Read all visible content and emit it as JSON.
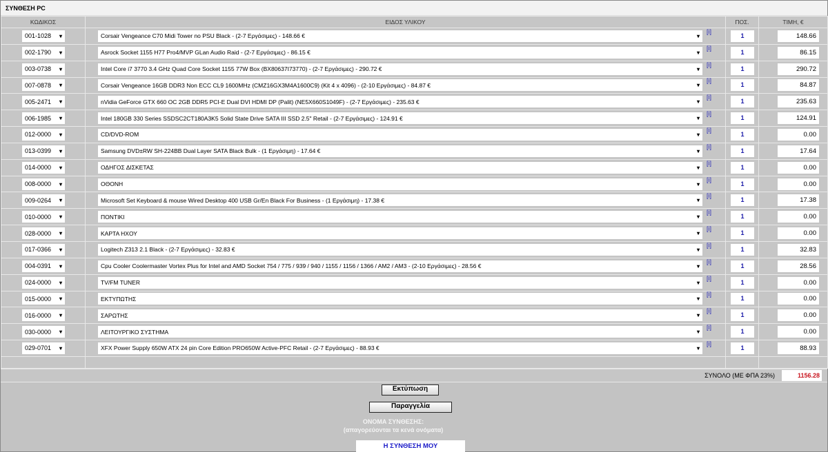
{
  "title": "ΣΥΝΘΕΣΗ PC",
  "headers": {
    "code": "ΚΩΔΙΚΟΣ",
    "desc": "ΕΙΔΟΣ ΥΛΙΚΟΥ",
    "qty": "ΠΟΣ.",
    "price": "ΤΙΜΗ, €"
  },
  "info_label": "[i]",
  "rows": [
    {
      "code": "001-1028",
      "desc": "Corsair Vengeance C70 Midi Tower no PSU Black - (2-7 Εργάσιμες) - 148.66 €",
      "qty": "1",
      "price": "148.66"
    },
    {
      "code": "002-1790",
      "desc": "Asrock Socket 1155 H77 Pro4/MVP GLan Audio Raid - (2-7 Εργάσιμες) - 86.15 €",
      "qty": "1",
      "price": "86.15"
    },
    {
      "code": "003-0738",
      "desc": "Intel Core i7 3770 3.4 GHz Quad Core Socket 1155 77W Box (BX80637I73770) - (2-7 Εργάσιμες) - 290.72 €",
      "qty": "1",
      "price": "290.72"
    },
    {
      "code": "007-0878",
      "desc": "Corsair Vengeance 16GB DDR3 Non ECC CL9 1600MHz (CMZ16GX3M4A1600C9) (Kit 4 x 4096) - (2-10 Εργάσιμες) - 84.87 €",
      "qty": "1",
      "price": "84.87"
    },
    {
      "code": "005-2471",
      "desc": "nVidia GeForce GTX 660 OC 2GB DDR5 PCI-E Dual DVI HDMI DP (Palit) (NE5X660S1049F) - (2-7 Εργάσιμες) - 235.63 €",
      "qty": "1",
      "price": "235.63"
    },
    {
      "code": "006-1985",
      "desc": "Intel 180GB 330 Series SSDSC2CT180A3K5 Solid State Drive SATA III SSD 2.5\" Retail - (2-7 Εργάσιμες) - 124.91 €",
      "qty": "1",
      "price": "124.91"
    },
    {
      "code": "012-0000",
      "desc": "CD/DVD-ROM",
      "qty": "1",
      "price": "0.00"
    },
    {
      "code": "013-0399",
      "desc": "Samsung DVD±RW SH-224BB Dual Layer SATA Black Bulk - (1 Εργάσιμη) - 17.64 €",
      "qty": "1",
      "price": "17.64"
    },
    {
      "code": "014-0000",
      "desc": "ΟΔΗΓΟΣ ΔΙΣΚΕΤΑΣ",
      "qty": "1",
      "price": "0.00"
    },
    {
      "code": "008-0000",
      "desc": "ΟΘΟΝΗ",
      "qty": "1",
      "price": "0.00"
    },
    {
      "code": "009-0264",
      "desc": "Microsoft Set Keyboard & mouse Wired Desktop 400 USB Gr/En Black For Business - (1 Εργάσιμη) - 17.38 €",
      "qty": "1",
      "price": "17.38"
    },
    {
      "code": "010-0000",
      "desc": "ΠΟΝΤΙΚΙ",
      "qty": "1",
      "price": "0.00"
    },
    {
      "code": "028-0000",
      "desc": "ΚΑΡΤΑ ΗΧΟΥ",
      "qty": "1",
      "price": "0.00"
    },
    {
      "code": "017-0366",
      "desc": "Logitech Z313 2.1 Black - (2-7 Εργάσιμες) - 32.83 €",
      "qty": "1",
      "price": "32.83"
    },
    {
      "code": "004-0391",
      "desc": "Cpu Cooler Coolermaster Vortex Plus for Intel and AMD Socket 754 / 775 / 939 / 940 / 1155 / 1156 / 1366 / AM2 / AM3 - (2-10 Εργάσιμες) - 28.56 €",
      "qty": "1",
      "price": "28.56"
    },
    {
      "code": "024-0000",
      "desc": "TV/FM TUNER",
      "qty": "1",
      "price": "0.00"
    },
    {
      "code": "015-0000",
      "desc": "ΕΚΤΥΠΩΤΗΣ",
      "qty": "1",
      "price": "0.00"
    },
    {
      "code": "016-0000",
      "desc": "ΣΑΡΩΤΗΣ",
      "qty": "1",
      "price": "0.00"
    },
    {
      "code": "030-0000",
      "desc": "ΛΕΙΤΟΥΡΓΙΚΟ ΣΥΣΤΗΜΑ",
      "qty": "1",
      "price": "0.00"
    },
    {
      "code": "029-0701",
      "desc": "XFX Power Supply 650W ATX 24 pin Core Edition PRO650W Active-PFC Retail - (2-7 Εργάσιμες) - 88.93 €",
      "qty": "1",
      "price": "88.93"
    }
  ],
  "total": {
    "label": "ΣΥΝΟΛΟ (ΜΕ ΦΠΑ 23%)",
    "value": "1156.28"
  },
  "buttons": {
    "print": "Εκτύπωση",
    "order": "Παραγγελία"
  },
  "name_label": "ΟΝΟΜΑ ΣΥΝΘΕΣΗΣ:",
  "name_hint": "(απαγορεύονται τα κενά ονόματα)",
  "name_value": "Η ΣΥΝΘΕΣΗ ΜΟΥ"
}
